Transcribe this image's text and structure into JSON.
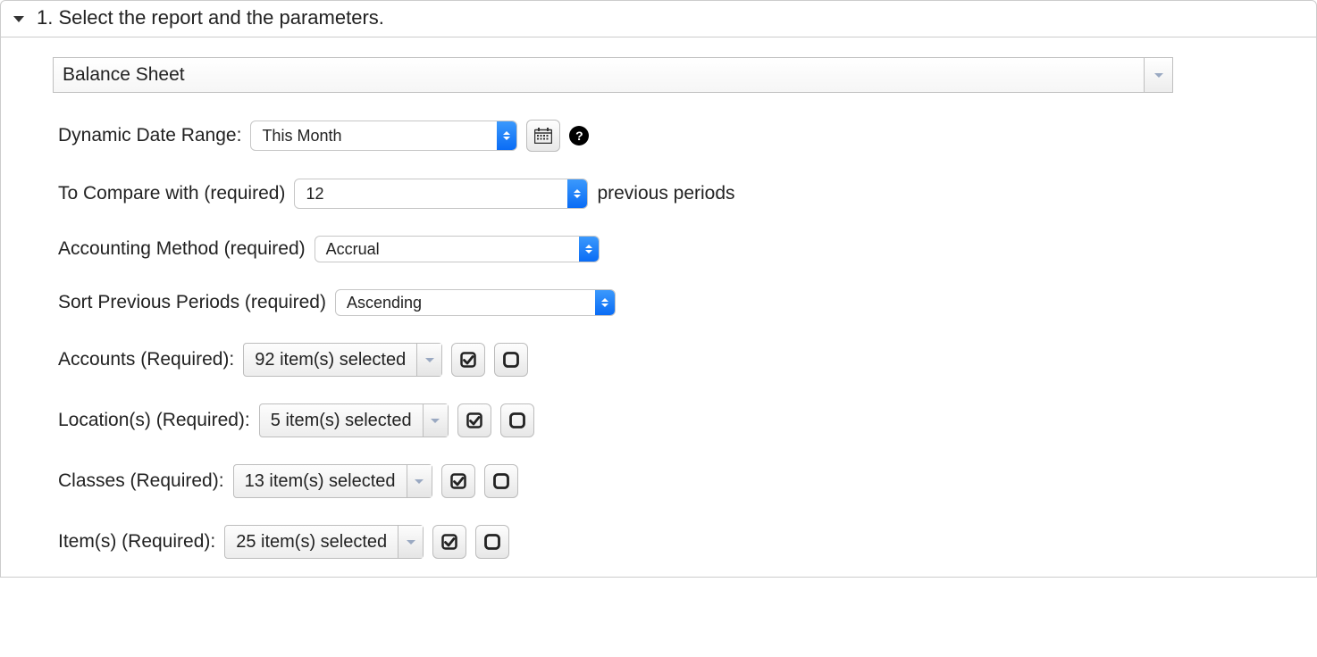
{
  "header": {
    "title": "1. Select the report and the parameters."
  },
  "report_select": {
    "value": "Balance Sheet"
  },
  "date_range": {
    "label": "Dynamic Date Range:",
    "value": "This Month"
  },
  "compare": {
    "label": "To Compare with (required)",
    "value": "12",
    "suffix": "previous periods"
  },
  "accounting_method": {
    "label": "Accounting Method (required)",
    "value": "Accrual"
  },
  "sort_periods": {
    "label": "Sort Previous Periods (required)",
    "value": "Ascending"
  },
  "accounts": {
    "label": "Accounts (Required):",
    "value": "92 item(s) selected"
  },
  "locations": {
    "label": "Location(s) (Required):",
    "value": "5 item(s) selected"
  },
  "classes": {
    "label": "Classes (Required):",
    "value": "13 item(s) selected"
  },
  "items": {
    "label": "Item(s) (Required):",
    "value": "25 item(s) selected"
  }
}
